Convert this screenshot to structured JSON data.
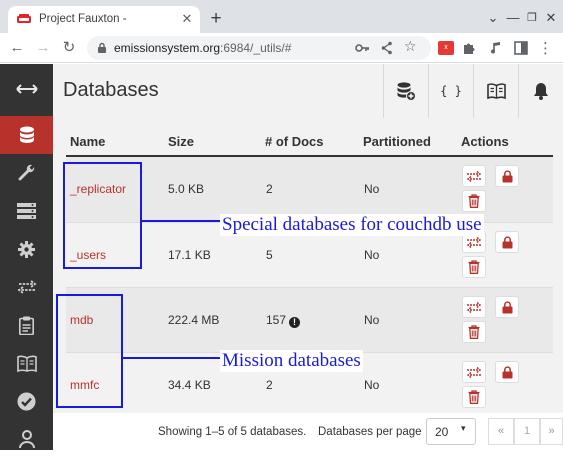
{
  "browser": {
    "tab_title": "Project Fauxton -",
    "url_host": "emissionsystem.org",
    "url_rest": ":6984/_utils/#"
  },
  "sidebar": {
    "items": [
      {
        "icon": "expand-arrows-icon"
      },
      {
        "icon": "database-icon",
        "active": true
      },
      {
        "icon": "wrench-icon"
      },
      {
        "icon": "server-icon"
      },
      {
        "icon": "gear-icon"
      },
      {
        "icon": "replication-icon"
      },
      {
        "icon": "clipboard-icon"
      },
      {
        "icon": "book-icon"
      },
      {
        "icon": "check-circle-icon"
      },
      {
        "icon": "user-icon"
      }
    ]
  },
  "header": {
    "title": "Databases",
    "buttons": [
      "create-database-icon",
      "json-icon",
      "docs-book-icon",
      "notification-bell-icon"
    ],
    "json_label": "{ }"
  },
  "table": {
    "columns": [
      "Name",
      "Size",
      "# of Docs",
      "Partitioned",
      "Actions"
    ],
    "rows": [
      {
        "name": "_replicator",
        "size": "5.0 KB",
        "docs": "2",
        "partitioned": "No",
        "warning": false
      },
      {
        "name": "_users",
        "size": "17.1 KB",
        "docs": "5",
        "partitioned": "No",
        "warning": false
      },
      {
        "name": "mdb",
        "size": "222.4 MB",
        "docs": "157",
        "partitioned": "No",
        "warning": true
      },
      {
        "name": "mmfc",
        "size": "34.4 KB",
        "docs": "2",
        "partitioned": "No",
        "warning": false
      }
    ]
  },
  "annotations": {
    "special": "Special databases for couchdb use",
    "mission": "Mission databases"
  },
  "footer": {
    "showing": "Showing 1–5 of 5 databases.",
    "per_page_label": "Databases per page",
    "per_page_value": "20",
    "prev": "«",
    "page": "1",
    "next": "»"
  },
  "colors": {
    "accent": "#b8322c",
    "sidebar": "#333333",
    "annotation": "#1a1adc"
  }
}
